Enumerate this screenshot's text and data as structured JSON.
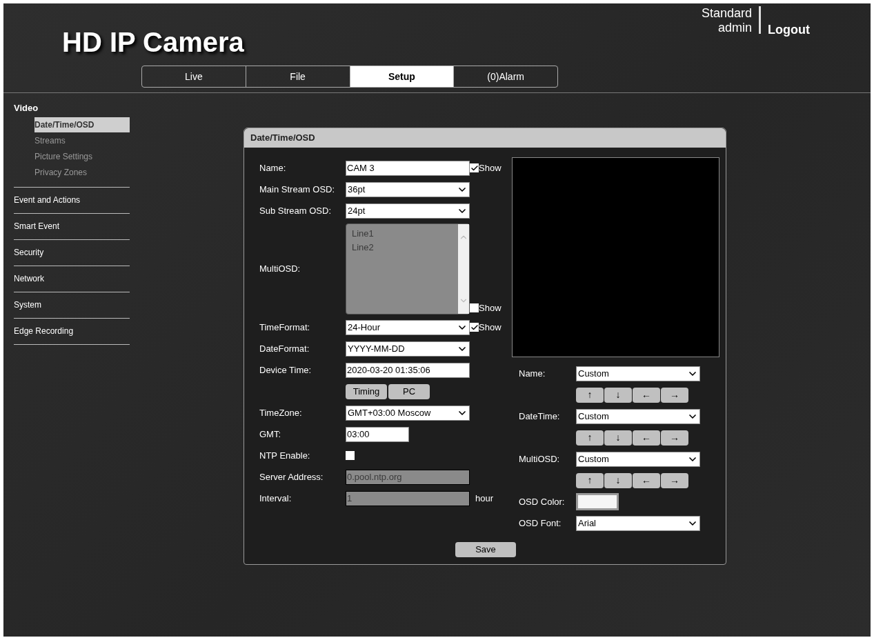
{
  "header": {
    "title": "HD IP Camera",
    "user_role": "Standard",
    "user_name": "admin",
    "logout": "Logout"
  },
  "tabs": [
    {
      "label": "Live",
      "selected": false
    },
    {
      "label": "File",
      "selected": false
    },
    {
      "label": "Setup",
      "selected": true
    },
    {
      "label": "(0)Alarm",
      "selected": false
    }
  ],
  "sidebar": {
    "items": [
      {
        "label": "Video",
        "children": [
          {
            "label": "Date/Time/OSD",
            "selected": true
          },
          {
            "label": "Streams",
            "selected": false
          },
          {
            "label": "Picture Settings",
            "selected": false
          },
          {
            "label": "Privacy Zones",
            "selected": false
          }
        ]
      },
      {
        "label": "Event and Actions"
      },
      {
        "label": "Smart Event"
      },
      {
        "label": "Security"
      },
      {
        "label": "Network"
      },
      {
        "label": "System"
      },
      {
        "label": "Edge Recording"
      }
    ]
  },
  "panel": {
    "title": "Date/Time/OSD",
    "left_rows": [
      {
        "kind": "text",
        "label": "Name:",
        "value": "CAM 3",
        "show": {
          "label": "Show",
          "checked": true
        }
      },
      {
        "kind": "select",
        "label": "Main Stream OSD:",
        "value": "36pt"
      },
      {
        "kind": "select",
        "label": "Sub Stream OSD:",
        "value": "24pt"
      },
      {
        "kind": "list",
        "label": "MultiOSD:",
        "lines": [
          "Line1",
          "Line2"
        ],
        "show": {
          "label": "Show",
          "checked": false
        }
      },
      {
        "kind": "select",
        "label": "TimeFormat:",
        "value": "24-Hour",
        "show": {
          "label": "Show",
          "checked": true
        }
      },
      {
        "kind": "select",
        "label": "DateFormat:",
        "value": "YYYY-MM-DD"
      },
      {
        "kind": "text",
        "label": "Device Time:",
        "value": "2020-03-20 01:35:06"
      },
      {
        "kind": "buttons",
        "buttons": [
          "Timing",
          "PC"
        ]
      },
      {
        "kind": "select",
        "label": "TimeZone:",
        "value": "GMT+03:00 Moscow"
      },
      {
        "kind": "short",
        "label": "GMT:",
        "value": "03:00"
      },
      {
        "kind": "checkbox",
        "label": "NTP Enable:",
        "checked": false
      },
      {
        "kind": "text",
        "label": "Server Address:",
        "value": "0.pool.ntp.org",
        "disabled": true
      },
      {
        "kind": "text",
        "label": "Interval:",
        "value": "1",
        "disabled": true,
        "suffix": "hour"
      }
    ],
    "right_rows": [
      {
        "kind": "position",
        "label": "Name:",
        "value": "Custom",
        "arrows": [
          "↑",
          "↓",
          "←",
          "→"
        ]
      },
      {
        "kind": "position",
        "label": "DateTime:",
        "value": "Custom",
        "arrows": [
          "↑",
          "↓",
          "←",
          "→"
        ]
      },
      {
        "kind": "position",
        "label": "MultiOSD:",
        "value": "Custom",
        "arrows": [
          "↑",
          "↓",
          "←",
          "→"
        ]
      },
      {
        "kind": "color",
        "label": "OSD Color:"
      },
      {
        "kind": "select",
        "label": "OSD Font:",
        "value": "Arial"
      }
    ],
    "save": "Save"
  }
}
